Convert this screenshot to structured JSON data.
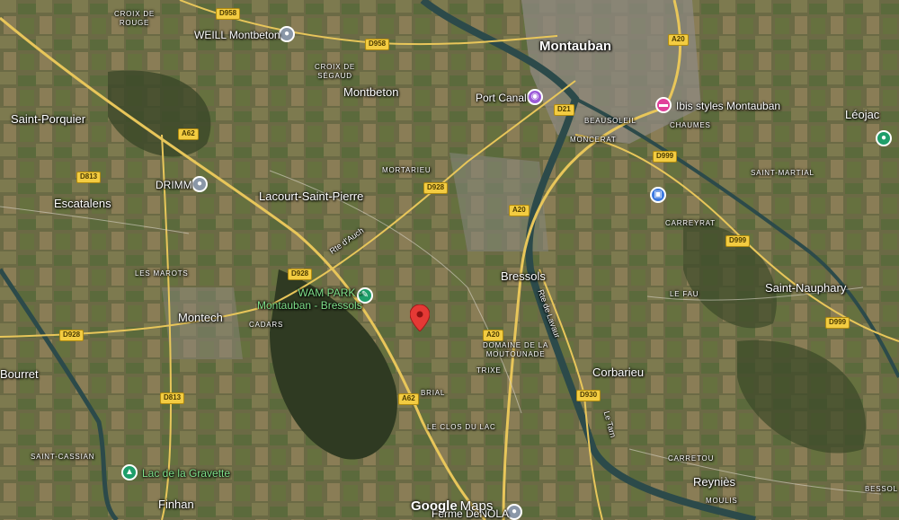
{
  "map": {
    "place_labels": [
      {
        "key": "montauban",
        "text": "Montauban"
      },
      {
        "key": "montbeton",
        "text": "Montbeton"
      },
      {
        "key": "saint_porquier",
        "text": "Saint-Porquier"
      },
      {
        "key": "escatalens",
        "text": "Escatalens"
      },
      {
        "key": "lacourt",
        "text": "Lacourt-Saint-Pierre"
      },
      {
        "key": "montech",
        "text": "Montech"
      },
      {
        "key": "bressols",
        "text": "Bressols"
      },
      {
        "key": "saint_nauphary",
        "text": "Saint-Nauphary"
      },
      {
        "key": "corbarieu",
        "text": "Corbarieu"
      },
      {
        "key": "leojac",
        "text": "Léojac"
      },
      {
        "key": "bourret",
        "text": "Bourret"
      },
      {
        "key": "finhan",
        "text": "Finhan"
      },
      {
        "key": "reynies",
        "text": "Reyniès"
      }
    ],
    "locality_labels": [
      {
        "key": "croix_rouge",
        "text": "CROIX DE\nROUGE"
      },
      {
        "key": "croix_segaud",
        "text": "CROIX DE\nSÉGAUD"
      },
      {
        "key": "mortarieu",
        "text": "MORTARIEU"
      },
      {
        "key": "les_marots",
        "text": "LES MAROTS"
      },
      {
        "key": "cadars",
        "text": "CADARS"
      },
      {
        "key": "beausoleil",
        "text": "BEAUSOLEIL"
      },
      {
        "key": "chaumes",
        "text": "CHAUMES"
      },
      {
        "key": "moncerat",
        "text": "MONCERAT"
      },
      {
        "key": "saint_martial",
        "text": "SAINT-MARTIAL"
      },
      {
        "key": "carreyrat",
        "text": "CARREYRAT"
      },
      {
        "key": "le_fau",
        "text": "LE FAU"
      },
      {
        "key": "domaine",
        "text": "DOMAINE DE LA\nMOUTOUNADE"
      },
      {
        "key": "trixe",
        "text": "TRIXE"
      },
      {
        "key": "brial",
        "text": "BRIAL"
      },
      {
        "key": "clos_du_lac",
        "text": "LE CLOS DU LAC"
      },
      {
        "key": "saint_cassian",
        "text": "SAINT-CASSIAN"
      },
      {
        "key": "carretou",
        "text": "CARRETOU"
      },
      {
        "key": "moulis",
        "text": "MOULIS"
      },
      {
        "key": "bessol",
        "text": "BESSOL"
      }
    ],
    "road_labels": [
      {
        "key": "rte_auch",
        "text": "Rte d'Auch"
      },
      {
        "key": "rte_lavaur",
        "text": "Rte de Lavaur"
      },
      {
        "key": "le_tarn",
        "text": "Le Tarn"
      }
    ],
    "shields": [
      {
        "key": "d958a",
        "text": "D958"
      },
      {
        "key": "d958b",
        "text": "D958"
      },
      {
        "key": "a20a",
        "text": "A20"
      },
      {
        "key": "a62a",
        "text": "A62"
      },
      {
        "key": "d813a",
        "text": "D813"
      },
      {
        "key": "d21",
        "text": "D21"
      },
      {
        "key": "d999a",
        "text": "D999"
      },
      {
        "key": "d928a",
        "text": "D928"
      },
      {
        "key": "a20b",
        "text": "A20"
      },
      {
        "key": "d999b",
        "text": "D999"
      },
      {
        "key": "d928b",
        "text": "D928"
      },
      {
        "key": "d928c",
        "text": "D928"
      },
      {
        "key": "a20c",
        "text": "A20"
      },
      {
        "key": "d999c",
        "text": "D999"
      },
      {
        "key": "d813b",
        "text": "D813"
      },
      {
        "key": "a62b",
        "text": "A62"
      },
      {
        "key": "d930",
        "text": "D930"
      }
    ],
    "pois": [
      {
        "key": "weill",
        "text": "WEILL Montbeton",
        "icon": "map-pin-icon",
        "color": "#8a97a8"
      },
      {
        "key": "port_canal",
        "text": "Port Canal",
        "icon": "camera-icon",
        "color": "#9c5bd8"
      },
      {
        "key": "ibis",
        "text": "Ibis styles Montauban",
        "icon": "bed-icon",
        "color": "#e0409a"
      },
      {
        "key": "drimm",
        "text": "DRIMM",
        "icon": "map-pin-icon",
        "color": "#8a97a8"
      },
      {
        "key": "briefcase",
        "text": "",
        "icon": "briefcase-icon",
        "color": "#3b78e0"
      },
      {
        "key": "leojac_pin",
        "text": "",
        "icon": "map-pin-icon",
        "color": "#1e9e6a"
      },
      {
        "key": "wam_park",
        "text": "WAM PARK -\nMontauban - Bressols",
        "icon": "wakeboard-icon",
        "color": "#1e9e6a"
      },
      {
        "key": "gravette",
        "text": "Lac de la Gravette",
        "icon": "tree-icon",
        "color": "#1e9e6a"
      },
      {
        "key": "ferme",
        "text": "Ferme DeNOLA",
        "icon": "map-pin-icon",
        "color": "#8a97a8"
      }
    ],
    "attribution": {
      "google": "Google",
      "maps": "Maps"
    }
  }
}
